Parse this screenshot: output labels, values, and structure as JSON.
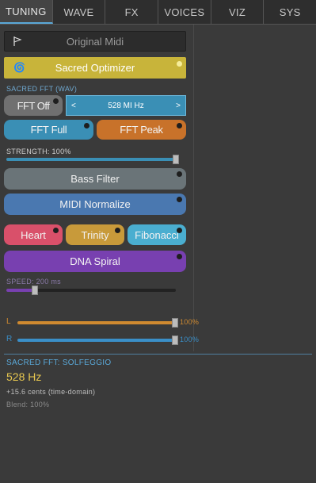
{
  "tabs": [
    "TUNING",
    "WAVE",
    "FX",
    "VOICES",
    "VIZ",
    "SYS"
  ],
  "original_midi": "Original Midi",
  "sacred_optimizer": "Sacred Optimizer",
  "sacred_fft_section": "SACRED FFT (WAV)",
  "fft_off": "FFT Off",
  "freq_selector": {
    "prev": "<",
    "value": "528 MI Hz",
    "next": ">"
  },
  "fft_full": "FFT Full",
  "fft_peak": "FFT Peak",
  "strength_label": "STRENGTH: 100%",
  "strength_value": 1.0,
  "bass_filter": "Bass Filter",
  "midi_normalize": "MIDI Normalize",
  "heart": "Heart",
  "trinity": "Trinity",
  "fibonacci": "Fibonacci",
  "dna_spiral": "DNA Spiral",
  "speed_label": "SPEED: 200 ms",
  "speed_value": 0.17,
  "left_channel": {
    "label": "L",
    "value_text": "100%",
    "value": 1.0
  },
  "right_channel": {
    "label": "R",
    "value_text": "100%",
    "value": 1.0
  },
  "status": {
    "title": "SACRED FFT: SOLFEGGIO",
    "frequency": "528 Hz",
    "cents": "+15.6 cents (time-domain)",
    "blend": "Blend: 100%"
  },
  "colors": {
    "optimizer": "#c8b43a",
    "fft_blue": "#3a8fb5",
    "fft_orange": "#c8722a",
    "heart": "#d9506a",
    "trinity": "#c89a3a",
    "fibonacci": "#4aaed0",
    "dna": "#7840b0",
    "channel_l": "#d08a30",
    "channel_r": "#3a8fc8"
  }
}
